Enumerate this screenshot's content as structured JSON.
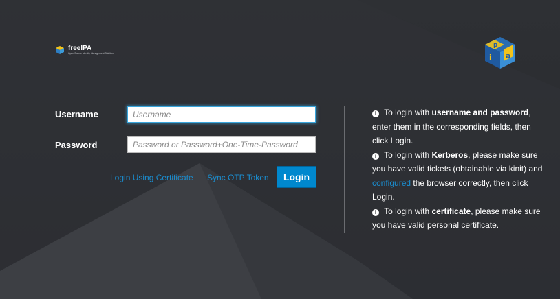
{
  "brand": {
    "name": "freeIPA",
    "tagline": "Open Source Identity Management Solution"
  },
  "form": {
    "username_label": "Username",
    "username_placeholder": "Username",
    "username_value": "",
    "password_label": "Password",
    "password_placeholder": "Password or Password+One-Time-Password",
    "password_value": ""
  },
  "actions": {
    "cert_link": "Login Using Certificate",
    "otp_link": "Sync OTP Token",
    "login_button": "Login"
  },
  "help": {
    "p1": {
      "prefix": " To login with ",
      "bold": "username and password",
      "suffix": ", enter them in the corresponding fields, then click Login."
    },
    "p2": {
      "prefix": " To login with ",
      "bold": "Kerberos",
      "middle": ", please make sure you have valid tickets (obtainable via kinit) and ",
      "link": "configured",
      "suffix": " the browser correctly, then click Login."
    },
    "p3": {
      "prefix": " To login with ",
      "bold": "certificate",
      "suffix": ", please make sure you have valid personal certificate."
    }
  },
  "colors": {
    "background": "#2b2d31",
    "accent": "#0088ce",
    "link": "#1a8ed1",
    "focus_glow": "#39a5dc"
  },
  "icons": [
    "freeipa-logo-mini",
    "freeipa-logo-cube",
    "info-icon"
  ]
}
